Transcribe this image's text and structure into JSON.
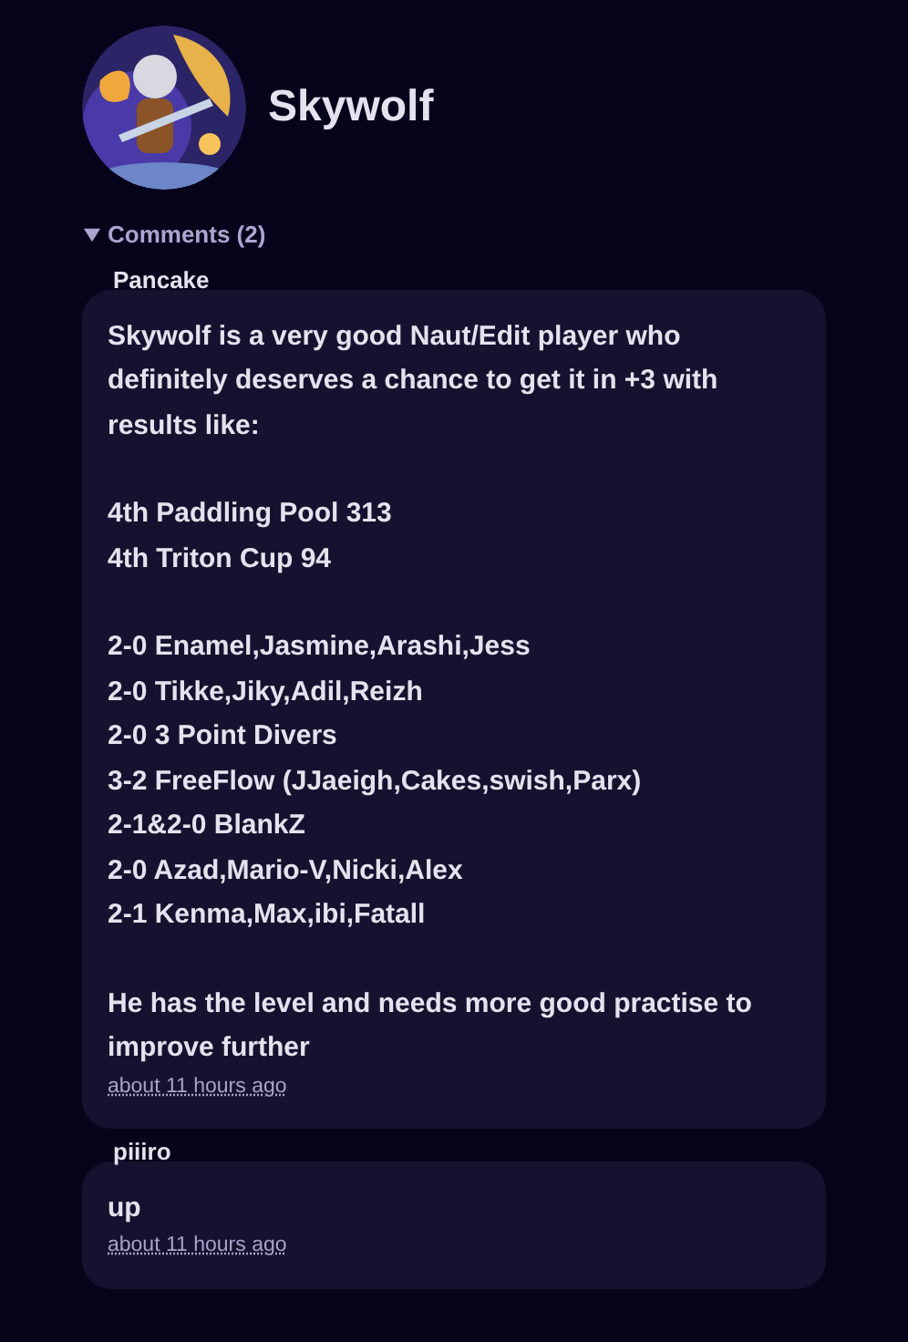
{
  "profile": {
    "name": "Skywolf"
  },
  "comments_section": {
    "label": "Comments (2)",
    "expanded": true,
    "comments": [
      {
        "author": "Pancake",
        "paragraphs": [
          [
            "Skywolf is a very good Naut/Edit player who definitely deserves a chance to get it in +3 with results like:"
          ],
          [
            "4th Paddling Pool 313",
            "4th Triton Cup 94"
          ],
          [
            "2-0 Enamel,Jasmine,Arashi,Jess",
            "2-0 Tikke,Jiky,Adil,Reizh",
            "2-0 3 Point Divers",
            "3-2 FreeFlow (JJaeigh,Cakes,swish,Parx)",
            "2-1&2-0 BlankZ",
            "2-0 Azad,Mario-V,Nicki,Alex",
            "2-1 Kenma,Max,ibi,Fatall"
          ],
          [
            "He has the level and needs more good practise to improve further"
          ]
        ],
        "time": "about 11 hours ago"
      },
      {
        "author": "piiiro",
        "paragraphs": [
          [
            "up"
          ]
        ],
        "time": "about 11 hours ago"
      }
    ]
  }
}
